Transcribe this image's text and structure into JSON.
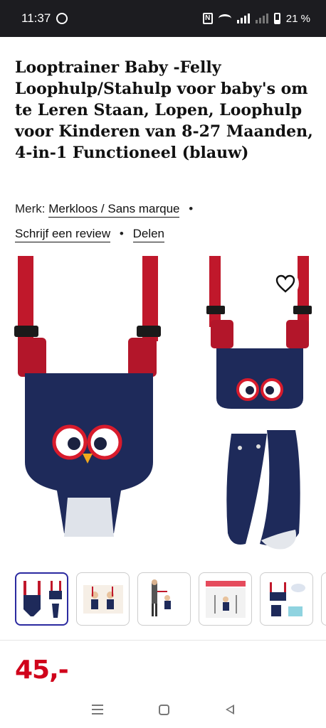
{
  "status_bar": {
    "time": "11:37",
    "battery": "21 %"
  },
  "product": {
    "title": "Looptrainer Baby -Felly Loophulp/Stahulp voor baby's om te Leren Staan, Lopen, Loophulp voor Kinderen van 8-27 Maanden, 4-in-1 Functioneel (blauw)",
    "brand_label": "Merk:",
    "brand": "Merkloos / Sans marque",
    "review_link": "Schrijf een review",
    "share_link": "Delen",
    "price": "45,-",
    "thumbnail_count": 5
  },
  "icons": {
    "favorite": "heart-icon",
    "whatsapp": "whatsapp-icon",
    "nfc": "nfc-icon",
    "wifi": "wifi-icon",
    "signal": "signal-icon",
    "battery": "battery-icon",
    "nav_recent": "menu-icon",
    "nav_home": "home-icon",
    "nav_back": "back-icon"
  },
  "colors": {
    "status_bar_bg": "#1c1c20",
    "price": "#d0021b",
    "active_thumb_border": "#2b2aa0",
    "harness_navy": "#1e2a5a",
    "harness_red": "#c0182b"
  }
}
